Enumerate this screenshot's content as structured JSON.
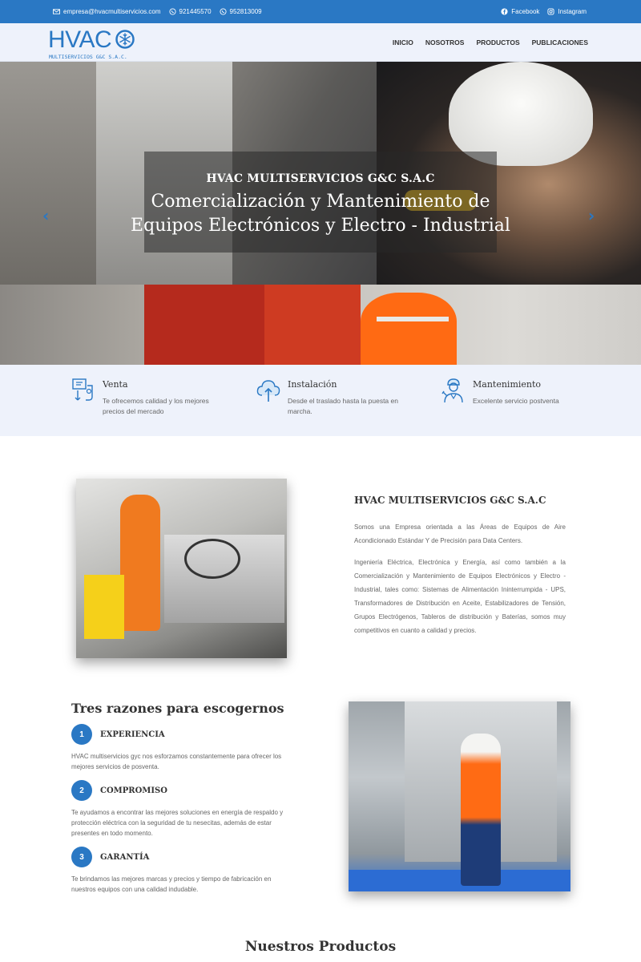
{
  "topbar": {
    "email": "empresa@hvacmultiservicios.com",
    "phone1": "921445570",
    "phone2": "952813009",
    "facebook": "Facebook",
    "instagram": "Instagram"
  },
  "header": {
    "logo_text": "HVAC",
    "logo_sub": "MULTISERVICIOS G&C S.A.C.",
    "nav": [
      "INICIO",
      "NOSOTROS",
      "PRODUCTOS",
      "PUBLICACIONES"
    ]
  },
  "hero": {
    "kicker": "HVAC MULTISERVICIOS G&C S.A.C",
    "title_line1": "Comercialización y Mantenimiento de",
    "title_line2": "Equipos Electrónicos y Electro - Industrial",
    "prev": "‹",
    "next": "›"
  },
  "services": [
    {
      "title": "Venta",
      "desc": "Te ofrecemos calidad y los mejores precios del mercado",
      "icon": "sale-icon"
    },
    {
      "title": "Instalación",
      "desc": "Desde el traslado hasta la puesta en marcha.",
      "icon": "cloud-upload-icon"
    },
    {
      "title": "Mantenimiento",
      "desc": "Excelente servicio postventa",
      "icon": "technician-icon"
    }
  ],
  "about": {
    "heading": "HVAC MULTISERVICIOS G&C S.A.C",
    "p1": "Somos una Empresa orientada a las Áreas de Equipos de Aire Acondicionado Estándar Y de Precisión para Data Centers.",
    "p2": "Ingeniería Eléctrica, Electrónica y Energía, así como también a la Comercialización y Mantenimiento de Equipos Electrónicos y Electro - Industrial, tales como: Sistemas de Alimentación Ininterrumpida - UPS, Transformadores de Distribución en Aceite, Estabilizadores de Tensión, Grupos Electrógenos, Tableros de distribución y Baterías, somos muy competitivos en cuanto a calidad y precios."
  },
  "reasons": {
    "heading": "Tres razones para escogernos",
    "items": [
      {
        "num": "1",
        "title": "EXPERIENCIA",
        "desc": "HVAC multiservicios gyc nos esforzamos constantemente para ofrecer los mejores servicios de posventa."
      },
      {
        "num": "2",
        "title": "COMPROMISO",
        "desc": "Te ayudamos a encontrar las mejores soluciones en energía de respaldo y protección eléctrica con la seguridad de tu nesecitas, además de estar presentes en todo momento."
      },
      {
        "num": "3",
        "title": "GARANTÍA",
        "desc": "Te brindamos las mejores marcas y precios y tiempo de fabricación en nuestros equipos con una calidad indudable."
      }
    ]
  },
  "products": {
    "heading": "Nuestros Productos"
  },
  "colors": {
    "accent": "#2a78c4",
    "light_bg": "#eef2fb"
  }
}
